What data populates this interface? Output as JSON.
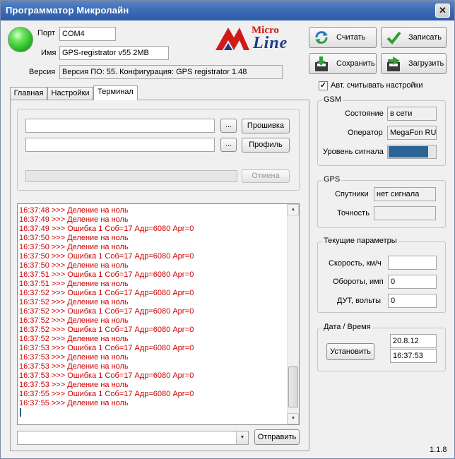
{
  "window": {
    "title": "Программатор Микролайн",
    "close_glyph": "✕"
  },
  "connection": {
    "port_label": "Порт",
    "port_value": "COM4",
    "name_label": "Имя",
    "name_value": "GPS-registrator v55 2MB",
    "version_label": "Версия",
    "version_value": "Версия ПО: 55. Конфигурация: GPS registrator 1.48",
    "status_led_color": "#2fbf2f"
  },
  "logo": {
    "word1": "Micro",
    "word2": "Line",
    "brand_red": "#d01a1a",
    "brand_blue": "#1e3a8a"
  },
  "toolbar": {
    "read_label": "Считать",
    "write_label": "Записать",
    "save_label": "Сохранить",
    "load_label": "Загрузить",
    "read_icon": "refresh-icon",
    "write_icon": "check-icon",
    "save_icon": "save-arrow-icon",
    "load_icon": "load-arrow-icon"
  },
  "auto_read": {
    "label": "Авт. считывать настройки",
    "checked": true
  },
  "tabs": [
    {
      "label": "Главная",
      "active": false
    },
    {
      "label": "Настройки",
      "active": false
    },
    {
      "label": "Терминал",
      "active": true
    }
  ],
  "terminal": {
    "firmware_path": "",
    "profile_path": "",
    "browse_label": "...",
    "firmware_button": "Прошивка",
    "profile_button": "Профиль",
    "cancel_button": "Отмена",
    "progress": 0,
    "log_lines": [
      "16:37:48 >>> Деление на ноль",
      "16:37:49 >>> Деление на ноль",
      "16:37:49 >>> Ошибка 1 Соб=17 Адр=6080 Арг=0",
      "16:37:50 >>> Деление на ноль",
      "16:37:50 >>> Деление на ноль",
      "16:37:50 >>> Ошибка 1 Соб=17 Адр=6080 Арг=0",
      "16:37:50 >>> Деление на ноль",
      "16:37:51 >>> Ошибка 1 Соб=17 Адр=6080 Арг=0",
      "16:37:51 >>> Деление на ноль",
      "16:37:52 >>> Ошибка 1 Соб=17 Адр=6080 Арг=0",
      "16:37:52 >>> Деление на ноль",
      "16:37:52 >>> Ошибка 1 Соб=17 Адр=6080 Арг=0",
      "16:37:52 >>> Деление на ноль",
      "16:37:52 >>> Ошибка 1 Соб=17 Адр=6080 Арг=0",
      "16:37:52 >>> Деление на ноль",
      "16:37:53 >>> Ошибка 1 Соб=17 Адр=6080 Арг=0",
      "16:37:53 >>> Деление на ноль",
      "16:37:53 >>> Деление на ноль",
      "16:37:53 >>> Ошибка 1 Соб=17 Адр=6080 Арг=0",
      "16:37:53 >>> Деление на ноль",
      "16:37:55 >>> Ошибка 1 Соб=17 Адр=6080 Арг=0",
      "16:37:55 >>> Деление на ноль"
    ],
    "log_color": "#d00000",
    "command_value": "",
    "send_button": "Отправить"
  },
  "gsm": {
    "title": "GSM",
    "state_label": "Состояние",
    "state_value": "в сети",
    "operator_label": "Оператор",
    "operator_value": "MegaFon RUS",
    "signal_label": "Уровень сигнала",
    "signal_level": 1.0,
    "signal_color": "#2a6496"
  },
  "gps": {
    "title": "GPS",
    "satellites_label": "Спутники",
    "satellites_value": "нет сигнала",
    "accuracy_label": "Точность",
    "accuracy_value": ""
  },
  "current_params": {
    "title": "Текущие параметры",
    "speed_label": "Скорость, км/ч",
    "speed_value": "",
    "rpm_label": "Обороты, имп",
    "rpm_value": "0",
    "fuel_label": "ДУТ, вольты",
    "fuel_value": "0"
  },
  "datetime": {
    "title": "Дата / Время",
    "set_button": "Установить",
    "date_value": "20.8.12",
    "time_value": "16:37:53"
  },
  "footer": {
    "app_version": "1.1.8"
  }
}
